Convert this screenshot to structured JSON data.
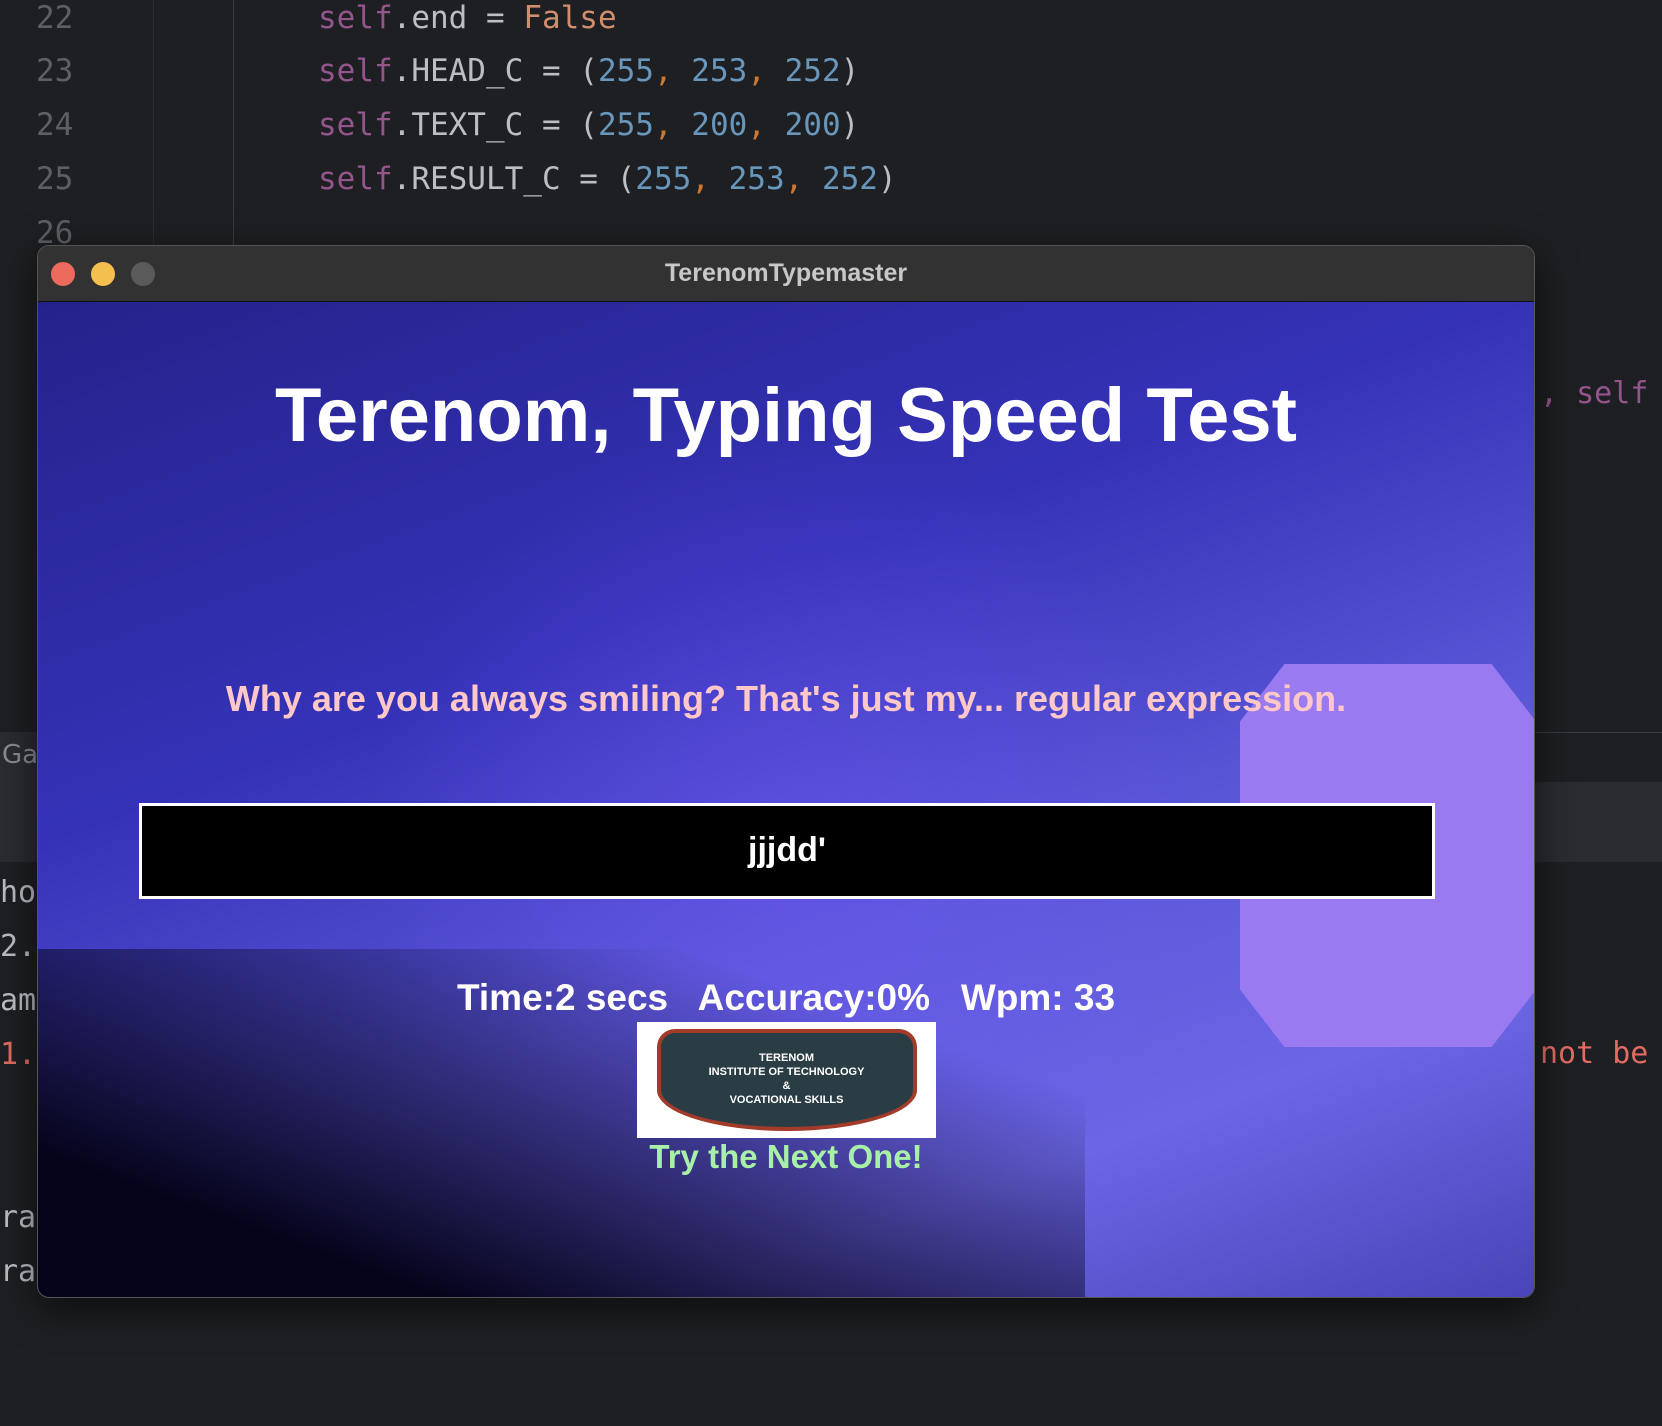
{
  "editor": {
    "line_numbers": [
      "22",
      "23",
      "24",
      "25",
      "26"
    ],
    "lines": [
      {
        "self": "self",
        "rest": ".end = ",
        "val": "False"
      },
      {
        "self": "self",
        "rest": ".HEAD_C = (",
        "n1": "255",
        "n2": "253",
        "n3": "252"
      },
      {
        "self": "self",
        "rest": ".TEXT_C = (",
        "n1": "255",
        "n2": "200",
        "n3": "200"
      },
      {
        "self": "self",
        "rest": ".RESULT_C = (",
        "n1": "255",
        "n2": "253",
        "n3": "252"
      }
    ],
    "right_fragments": {
      "self": ", self",
      "not_be": "not be"
    },
    "left_fragments": [
      "Ga",
      "ho",
      "2.",
      "am",
      "1.",
      "ra",
      "ra"
    ]
  },
  "window": {
    "title": "TerenomTypemaster"
  },
  "app": {
    "heading": "Terenom, Typing Speed Test",
    "sentence": "Why are you always smiling? That's just my... regular expression.",
    "input_value": "jjjdd'",
    "stats": {
      "time": "Time:2 secs",
      "accuracy": "Accuracy:0%",
      "wpm": "Wpm: 33"
    },
    "logo": {
      "line1": "TERENOM",
      "line2": "INSTITUTE OF TECHNOLOGY",
      "line3": "&",
      "line4": "VOCATIONAL SKILLS"
    },
    "next_label": "Try the Next One!"
  },
  "colors": {
    "head": "#fffdfc",
    "text": "#ffc8c8",
    "result": "#fffdfc",
    "next": "#a8f0a8"
  }
}
